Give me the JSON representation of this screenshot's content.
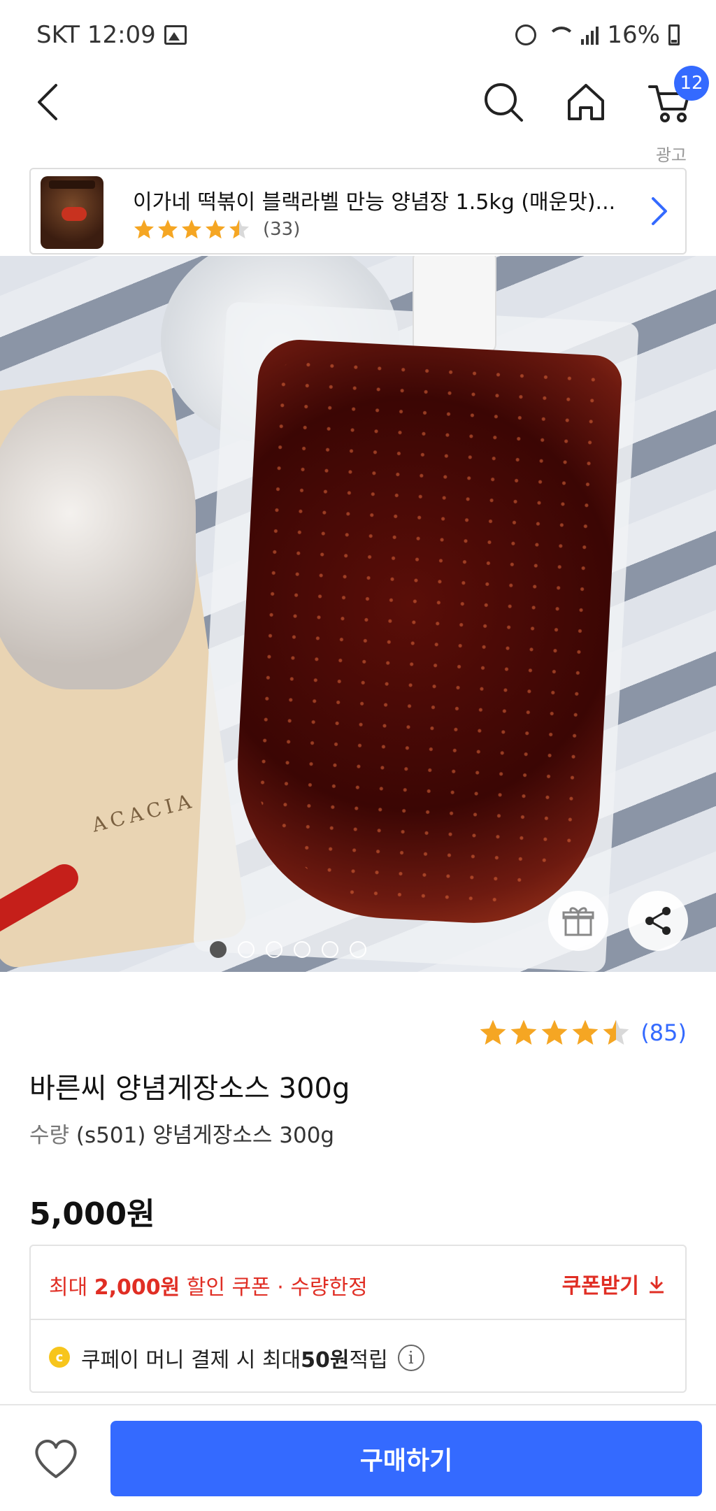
{
  "status_bar": {
    "carrier": "SKT",
    "time": "12:09",
    "battery": "16%"
  },
  "nav": {
    "cart_count": "12"
  },
  "ad": {
    "label": "광고",
    "title": "이가네 떡볶이 블랙라벨 만능 양념장 1.5kg (매운맛)...",
    "rating": 4.5,
    "review_count": "(33)"
  },
  "gallery": {
    "total_images": 6,
    "current_index": 1,
    "logo_text": "ACACIA"
  },
  "product": {
    "rating": 4.5,
    "review_count": "(85)",
    "name": "바른씨 양념게장소스 300g",
    "option_label": "수량",
    "option_value": "(s501) 양념게장소스 300g",
    "price": "5,000원"
  },
  "benefits": {
    "coupon_prefix": "최대 ",
    "coupon_amount": "2,000원",
    "coupon_suffix": " 할인 쿠폰 · 수량한정",
    "coupon_button": "쿠폰받기",
    "coin_symbol": "c",
    "pay_prefix": "쿠페이 머니 결제 시 최대 ",
    "pay_amount": "50원",
    "pay_suffix": " 적립",
    "info_symbol": "i"
  },
  "bottom": {
    "buy_label": "구매하기"
  },
  "colors": {
    "accent": "#346aff",
    "coupon": "#e02e24",
    "star": "#f5a623"
  }
}
